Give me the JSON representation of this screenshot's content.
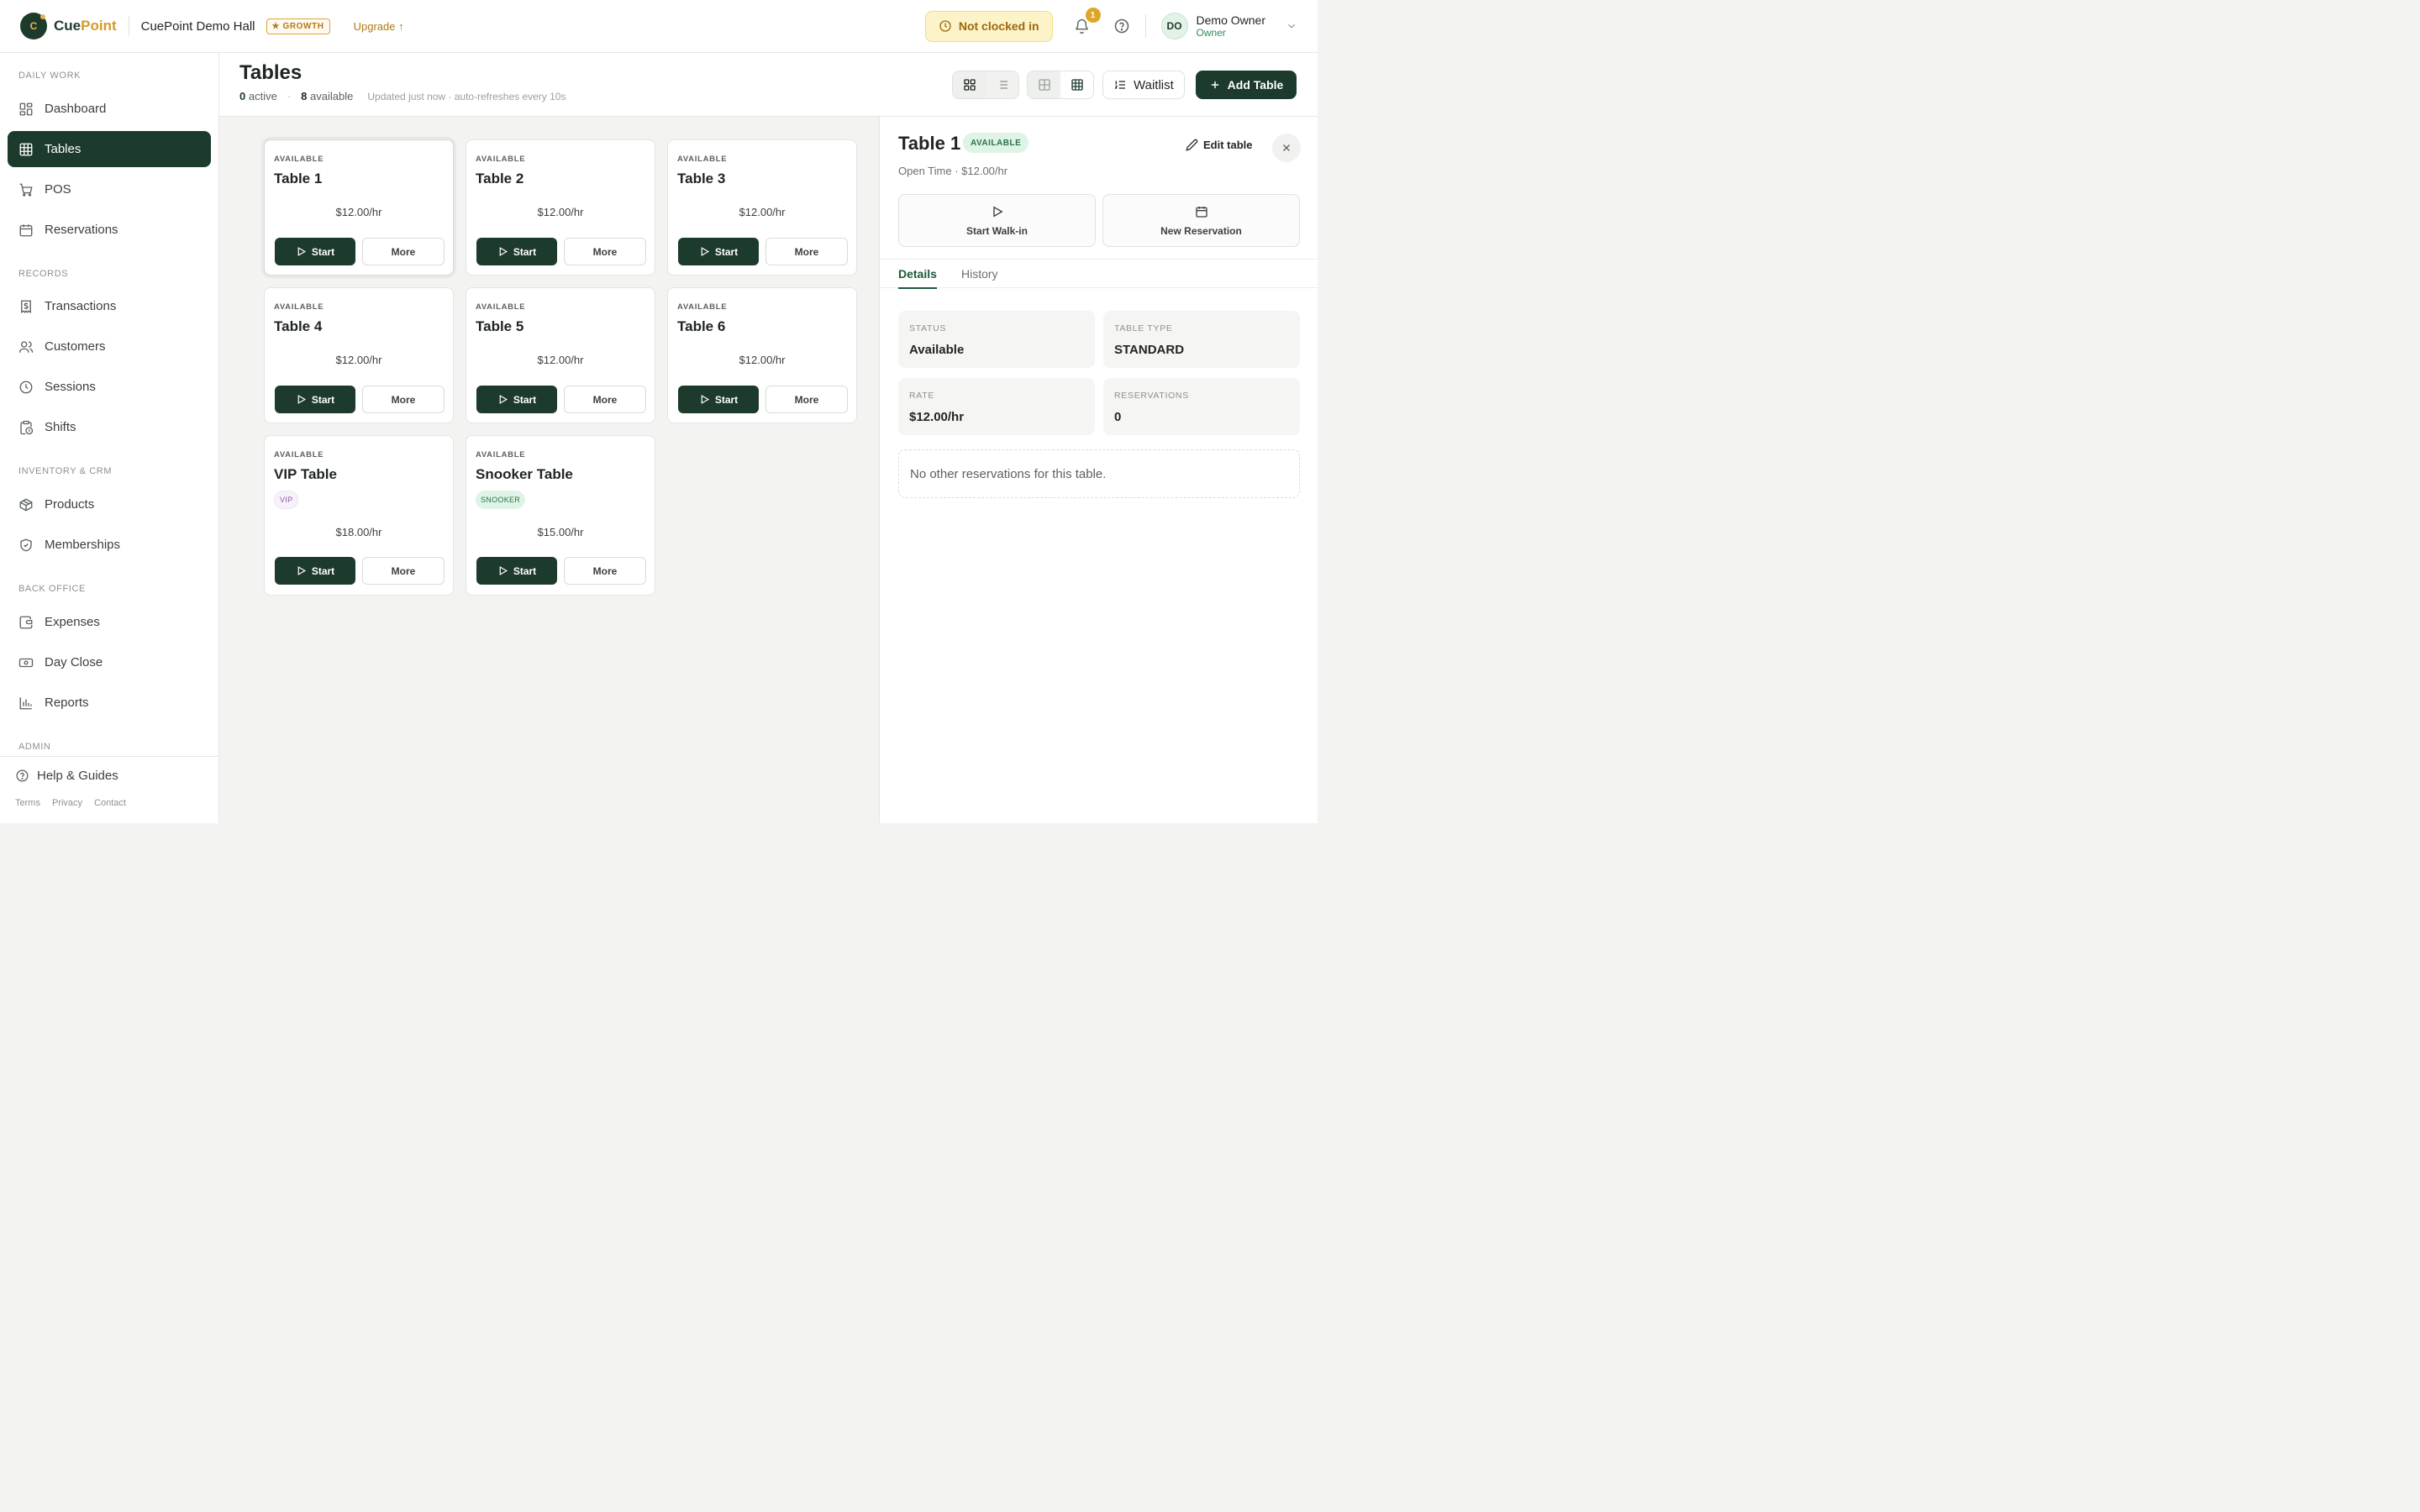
{
  "app": {
    "logo_letter": "C",
    "logo_part1": "Cue",
    "logo_part2": "Point",
    "venue": "CuePoint Demo Hall",
    "plan": "★ GROWTH",
    "upgrade": "Upgrade ↑"
  },
  "topbar": {
    "clock_status": "Not clocked in",
    "notifications_count": "1",
    "user_initials": "DO",
    "user_name": "Demo Owner",
    "user_role": "Owner"
  },
  "sidebar": {
    "sections": [
      "DAILY WORK",
      "RECORDS",
      "INVENTORY & CRM",
      "BACK OFFICE",
      "ADMIN"
    ],
    "items": [
      {
        "label": "Dashboard",
        "icon": "dashboard-icon"
      },
      {
        "label": "Tables",
        "icon": "grid-icon",
        "active": true
      },
      {
        "label": "POS",
        "icon": "cart-icon"
      },
      {
        "label": "Reservations",
        "icon": "calendar-icon"
      },
      {
        "label": "Transactions",
        "icon": "receipt-icon"
      },
      {
        "label": "Customers",
        "icon": "users-icon"
      },
      {
        "label": "Sessions",
        "icon": "clock-icon"
      },
      {
        "label": "Shifts",
        "icon": "clipboard-clock-icon"
      },
      {
        "label": "Products",
        "icon": "box-icon"
      },
      {
        "label": "Memberships",
        "icon": "shield-icon"
      },
      {
        "label": "Expenses",
        "icon": "wallet-icon"
      },
      {
        "label": "Day Close",
        "icon": "cash-icon"
      },
      {
        "label": "Reports",
        "icon": "bar-chart-icon"
      }
    ],
    "help": "Help & Guides",
    "legal": [
      "Terms",
      "Privacy",
      "Contact"
    ]
  },
  "page": {
    "title": "Tables",
    "active_count": "0",
    "active_label": "active",
    "available_count": "8",
    "available_label": "available",
    "updated": "Updated just now · auto-refreshes every 10s",
    "waitlist": "Waitlist",
    "add_table": "Add Table"
  },
  "tables": [
    {
      "status": "AVAILABLE",
      "name": "Table 1",
      "rate": "$12.00/hr",
      "tag": "",
      "start": "Start",
      "more": "More"
    },
    {
      "status": "AVAILABLE",
      "name": "Table 2",
      "rate": "$12.00/hr",
      "tag": "",
      "start": "Start",
      "more": "More"
    },
    {
      "status": "AVAILABLE",
      "name": "Table 3",
      "rate": "$12.00/hr",
      "tag": "",
      "start": "Start",
      "more": "More"
    },
    {
      "status": "AVAILABLE",
      "name": "Table 4",
      "rate": "$12.00/hr",
      "tag": "",
      "start": "Start",
      "more": "More"
    },
    {
      "status": "AVAILABLE",
      "name": "Table 5",
      "rate": "$12.00/hr",
      "tag": "",
      "start": "Start",
      "more": "More"
    },
    {
      "status": "AVAILABLE",
      "name": "Table 6",
      "rate": "$12.00/hr",
      "tag": "",
      "start": "Start",
      "more": "More"
    },
    {
      "status": "AVAILABLE",
      "name": "VIP Table",
      "rate": "$18.00/hr",
      "tag": "VIP",
      "start": "Start",
      "more": "More"
    },
    {
      "status": "AVAILABLE",
      "name": "Snooker Table",
      "rate": "$15.00/hr",
      "tag": "SNOOKER",
      "start": "Start",
      "more": "More"
    }
  ],
  "detail": {
    "title": "Table 1",
    "badge": "AVAILABLE",
    "edit": "Edit table",
    "subtitle": "Open Time · $12.00/hr",
    "start_walkin": "Start Walk-in",
    "new_reservation": "New Reservation",
    "tabs": [
      "Details",
      "History"
    ],
    "fields": [
      {
        "key": "STATUS",
        "value": "Available"
      },
      {
        "key": "TABLE TYPE",
        "value": "STANDARD"
      },
      {
        "key": "RATE",
        "value": "$12.00/hr"
      },
      {
        "key": "RESERVATIONS",
        "value": "0"
      }
    ],
    "empty": "No other reservations for this table."
  }
}
